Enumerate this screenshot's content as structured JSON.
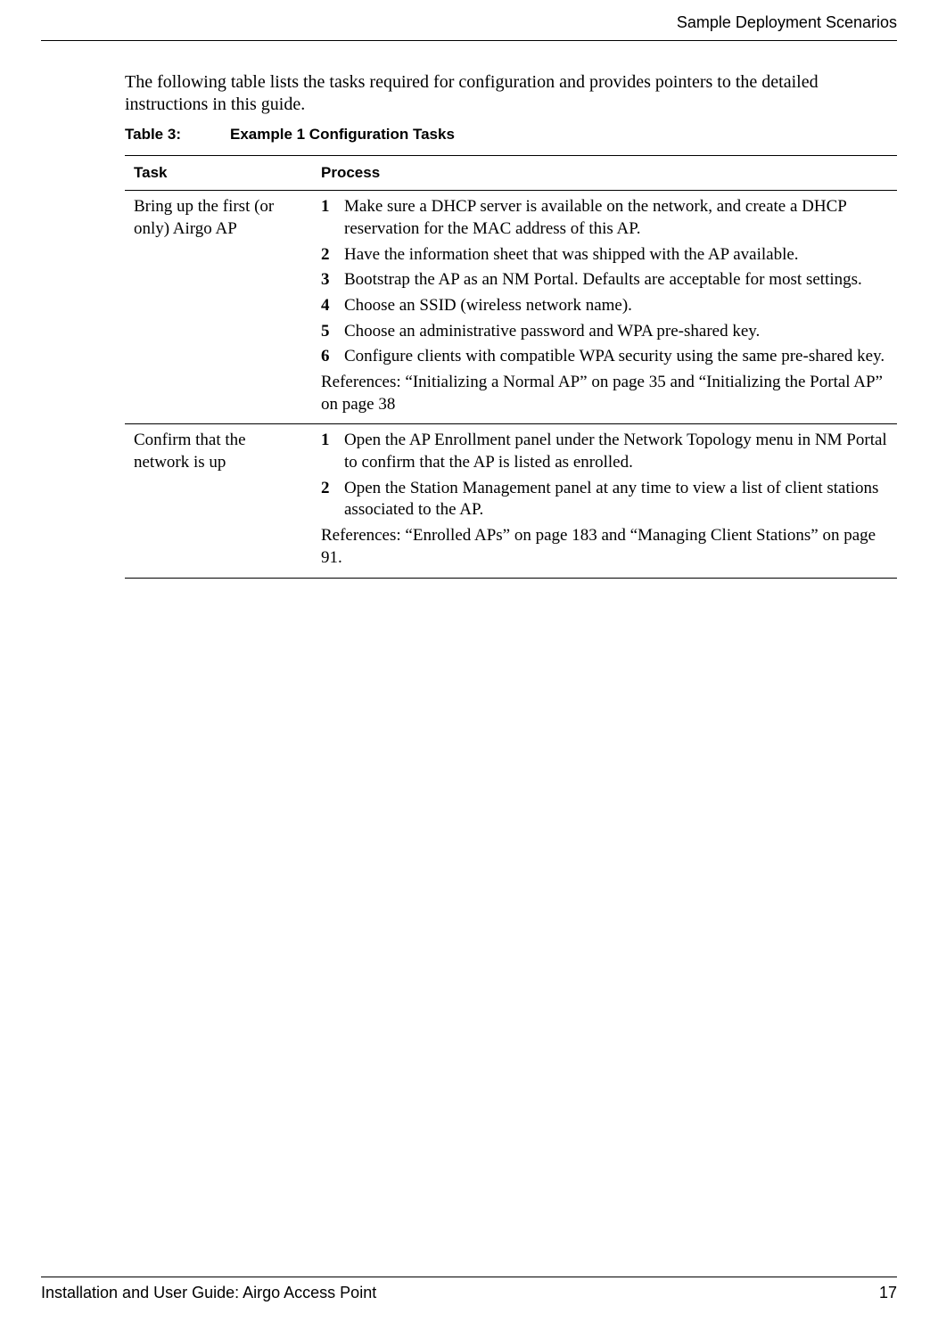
{
  "header": {
    "section_title": "Sample Deployment Scenarios"
  },
  "intro": "The following table lists the tasks required for configuration and provides pointers to the detailed instructions in this guide.",
  "table": {
    "caption_number": "Table 3:",
    "caption_title": "Example 1 Configuration Tasks",
    "columns": {
      "task": "Task",
      "process": "Process"
    },
    "rows": [
      {
        "task": "Bring up the first (or only) Airgo AP",
        "steps": [
          {
            "num": "1",
            "text": "Make sure a DHCP server is available on the network, and create a DHCP reservation for the MAC address of this AP."
          },
          {
            "num": "2",
            "text": "Have the information sheet that was shipped with the AP available."
          },
          {
            "num": "3",
            "text": "Bootstrap the AP as an NM Portal. Defaults are acceptable for most settings."
          },
          {
            "num": "4",
            "text": "Choose an SSID (wireless network name)."
          },
          {
            "num": "5",
            "text": "Choose an administrative password and WPA pre-shared key."
          },
          {
            "num": "6",
            "text": "Configure clients with compatible WPA security using the same pre-shared key."
          }
        ],
        "reference": "References: “Initializing a Normal AP” on page 35 and “Initializing the Portal AP” on page 38"
      },
      {
        "task": "Confirm that the network is up",
        "steps": [
          {
            "num": "1",
            "text": "Open the AP Enrollment panel under the Network Topology menu in NM Portal to confirm that the AP is listed as enrolled."
          },
          {
            "num": "2",
            "text": "Open the Station Management panel at any time to view a list of client stations associated to the AP."
          }
        ],
        "reference": "References: “Enrolled APs” on page 183 and “Managing Client Stations” on page 91."
      }
    ]
  },
  "footer": {
    "doc_title": "Installation and User Guide: Airgo Access Point",
    "page_number": "17"
  }
}
